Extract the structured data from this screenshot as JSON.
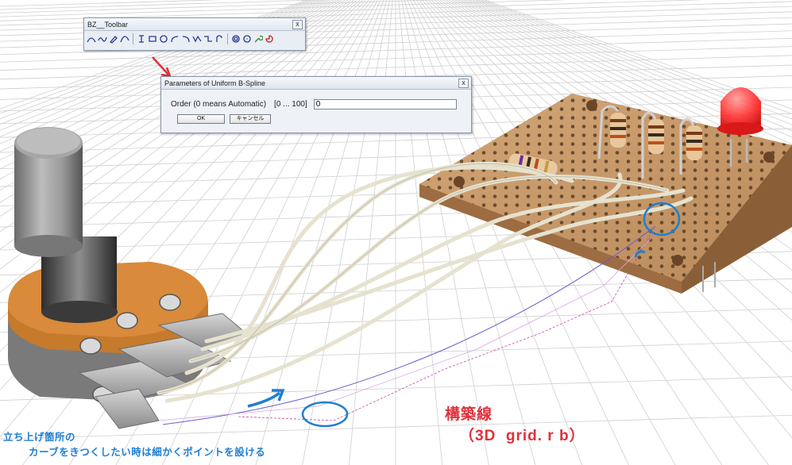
{
  "toolbar": {
    "title": "BZ__Toolbar",
    "close_label": "x",
    "icons": [
      "arc-icon",
      "wave-icon",
      "brush-icon",
      "curve-icon",
      "bspline-icon",
      "rectangle-icon",
      "circle-icon",
      "arc-left-icon",
      "arc-right-icon",
      "zigzag-icon",
      "step-icon",
      "hook-icon",
      "gear-icon",
      "circle-dot-icon",
      "wrench-icon",
      "pie-icon"
    ]
  },
  "dialog": {
    "title": "Parameters of Uniform B-Spline",
    "close_label": "x",
    "order_label": "Order (0 means Automatic)",
    "range_label": "[0 ... 100]",
    "order_value": "0",
    "ok_label": "OK",
    "cancel_label": "キャンセル"
  },
  "annotations": {
    "left_line1": "立ち上げ箇所の",
    "left_line2": "カーブをきつくしたい時は細かくポイントを設ける",
    "right_title": "構築線",
    "right_sub": "（3D  grid. r b）"
  },
  "colors": {
    "accent_blue": "#1f7fd1",
    "highlight_red": "#e0303a",
    "wire": "#d8d5c4",
    "board": "#b8865a",
    "knob": "#8a8a8a",
    "led": "#ff2020"
  }
}
